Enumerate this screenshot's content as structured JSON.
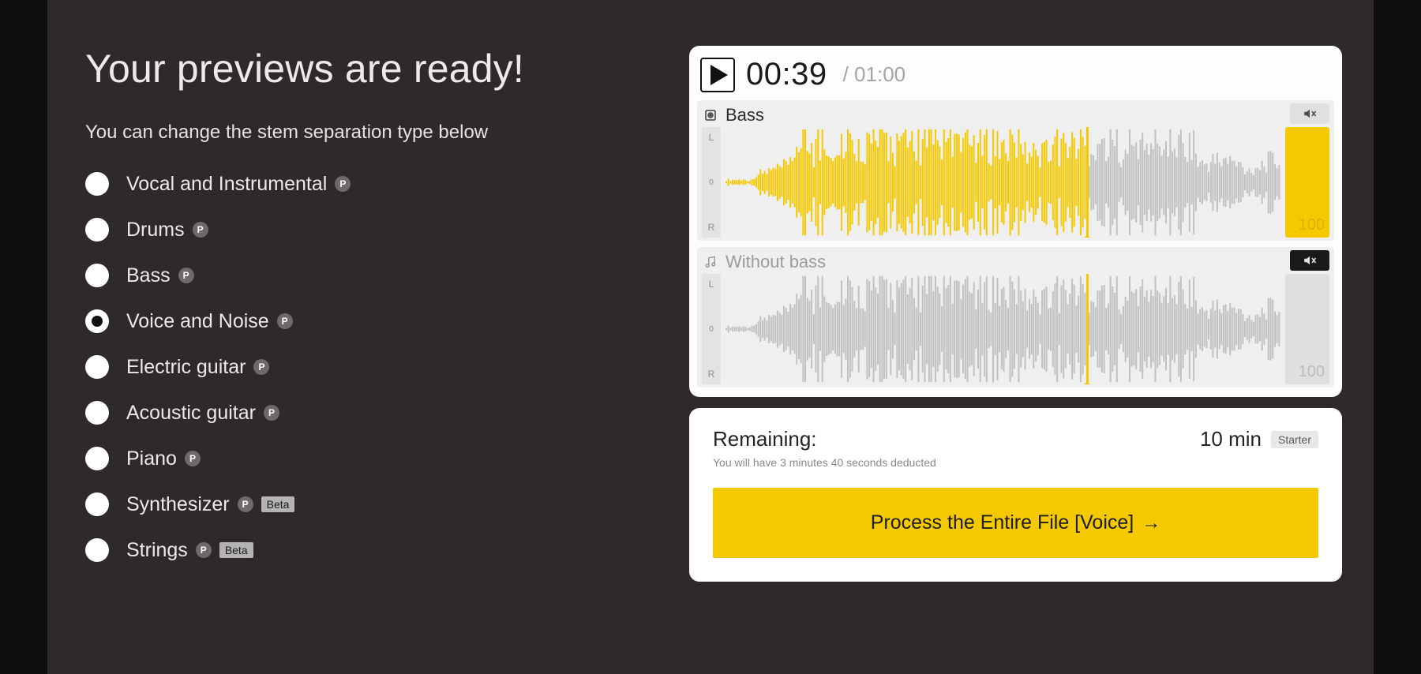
{
  "heading": "Your previews are ready!",
  "subheading": "You can change the stem separation type below",
  "options": [
    {
      "label": "Vocal and Instrumental",
      "p": true,
      "beta": false,
      "selected": false
    },
    {
      "label": "Drums",
      "p": true,
      "beta": false,
      "selected": false
    },
    {
      "label": "Bass",
      "p": true,
      "beta": false,
      "selected": false
    },
    {
      "label": "Voice and Noise",
      "p": true,
      "beta": false,
      "selected": true
    },
    {
      "label": "Electric guitar",
      "p": true,
      "beta": false,
      "selected": false
    },
    {
      "label": "Acoustic guitar",
      "p": true,
      "beta": false,
      "selected": false
    },
    {
      "label": "Piano",
      "p": true,
      "beta": false,
      "selected": false
    },
    {
      "label": "Synthesizer",
      "p": true,
      "beta": true,
      "selected": false
    },
    {
      "label": "Strings",
      "p": true,
      "beta": true,
      "selected": false
    }
  ],
  "p_glyph": "P",
  "beta_label": "Beta",
  "player": {
    "current": "00:39",
    "total": "/ 01:00",
    "progress_pct": 65
  },
  "tracks": [
    {
      "title": "Bass",
      "muted": false,
      "volume": 100
    },
    {
      "title": "Without bass",
      "muted": true,
      "volume": 100
    }
  ],
  "channels": {
    "l": "L",
    "zero": "0",
    "r": "R"
  },
  "footer": {
    "remaining_label": "Remaining:",
    "remaining_time": "10 min",
    "plan": "Starter",
    "deduction_note": "You will have 3 minutes 40 seconds deducted",
    "process_label": "Process the Entire File [Voice]",
    "arrow": "→"
  },
  "colors": {
    "accent": "#f5c900",
    "bg_dark": "#2e2a2b"
  }
}
